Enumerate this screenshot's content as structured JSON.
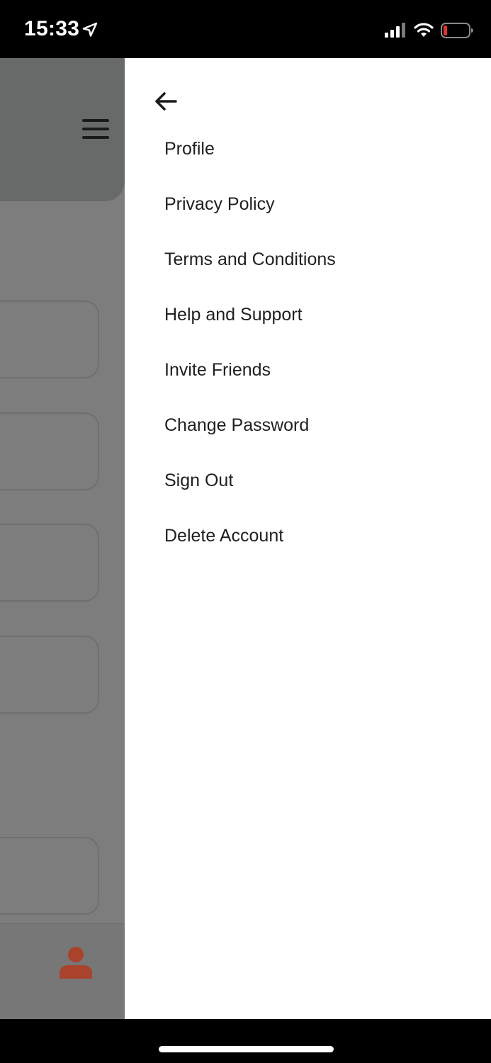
{
  "status_bar": {
    "time": "15:33",
    "icons": [
      "location-arrow-icon",
      "cellular-signal-icon",
      "wifi-icon",
      "battery-low-icon"
    ]
  },
  "background_app": {
    "icons": [
      "hamburger-menu-icon",
      "person-icon"
    ],
    "accent_color": "#a9432c"
  },
  "drawer": {
    "back_icon": "arrow-left-icon",
    "menu_items": [
      "Profile",
      "Privacy Policy",
      "Terms and Conditions",
      "Help and Support",
      "Invite Friends",
      "Change Password",
      "Sign Out",
      "Delete Account"
    ]
  }
}
